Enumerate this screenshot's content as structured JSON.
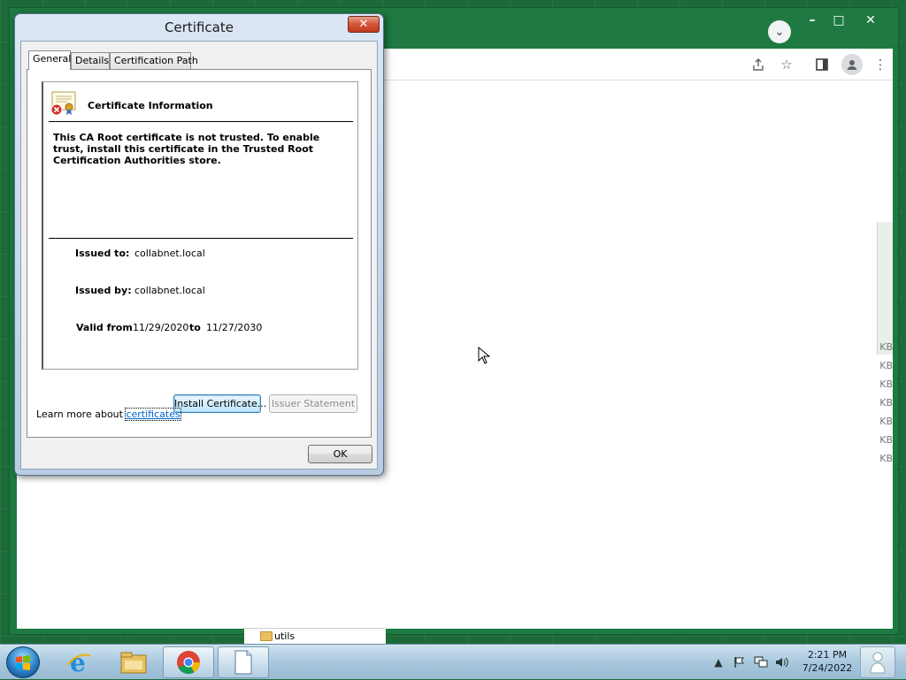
{
  "dialog": {
    "title": "Certificate",
    "close_label": "✕",
    "tabs": [
      {
        "label": "General"
      },
      {
        "label": "Details"
      },
      {
        "label": "Certification Path"
      }
    ],
    "info_header": "Certificate Information",
    "warning": "This CA Root certificate is not trusted. To enable trust, install this certificate in the Trusted Root Certification Authorities store.",
    "issued_to_label": "Issued to:",
    "issued_to": "collabnet.local",
    "issued_by_label": "Issued by:",
    "issued_by": "collabnet.local",
    "valid_from_label": "Valid from",
    "valid_from": "11/29/2020",
    "valid_to_label": "to",
    "valid_to": "11/27/2030",
    "install_button": "Install Certificate...",
    "issuer_statement_button": "Issuer Statement",
    "learn_more_prefix": "Learn more about",
    "learn_more_link": "certificates",
    "ok_button": "OK"
  },
  "browser": {
    "kb_labels": [
      "KB",
      "KB",
      "KB",
      "KB",
      "KB",
      "KB",
      "KB"
    ],
    "bg_file_name": "utils"
  },
  "taskbar": {
    "time": "2:21 PM",
    "date": "7/24/2022"
  },
  "colors": {
    "link": "#0066cc",
    "desktop": "#1d6a39",
    "chrome_frame": "#1e7a40",
    "close_button": "#c0391d"
  }
}
